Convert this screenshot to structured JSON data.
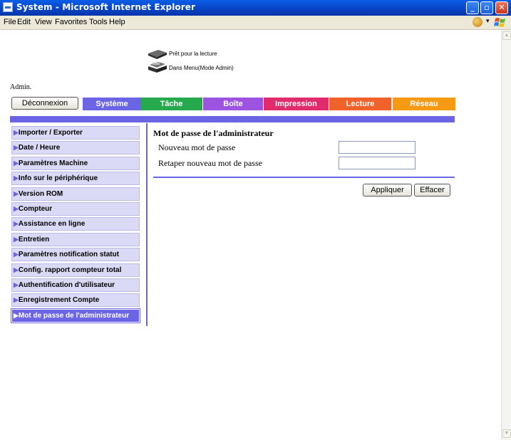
{
  "window": {
    "title": "System - Microsoft Internet Explorer"
  },
  "menubar": {
    "items": [
      "File",
      "Edit",
      "View",
      "Favorites",
      "Tools",
      "Help"
    ]
  },
  "status": {
    "line1": "Prêt pour la lecture",
    "line2": "Dans Menu(Mode Admin)"
  },
  "admin_label": "Admin.",
  "logout_label": "Déconnexion",
  "tabs": [
    {
      "label": "Système",
      "color": "#6b65e6"
    },
    {
      "label": "Tâche",
      "color": "#26a84c"
    },
    {
      "label": "Boîte",
      "color": "#9c53e0"
    },
    {
      "label": "Impression",
      "color": "#e02c6c"
    },
    {
      "label": "Lecture",
      "color": "#f0622a"
    },
    {
      "label": "Réseau",
      "color": "#f59a12"
    }
  ],
  "sidebar": {
    "items": [
      "Importer / Exporter",
      "Date / Heure",
      "Paramètres Machine",
      "Info sur le périphérique",
      "Version ROM",
      "Compteur",
      "Assistance en ligne",
      "Entretien",
      "Paramètres notification statut",
      "Config. rapport compteur total",
      "Authentification d'utilisateur",
      "Enregistrement Compte",
      "Mot de passe de l'administrateur"
    ],
    "active_index": 12
  },
  "form": {
    "title": "Mot de passe de l'administrateur",
    "fields": [
      {
        "label": "Nouveau mot de passe",
        "value": ""
      },
      {
        "label": "Retaper nouveau mot de passe",
        "value": ""
      }
    ],
    "apply_label": "Appliquer",
    "clear_label": "Effacer"
  }
}
